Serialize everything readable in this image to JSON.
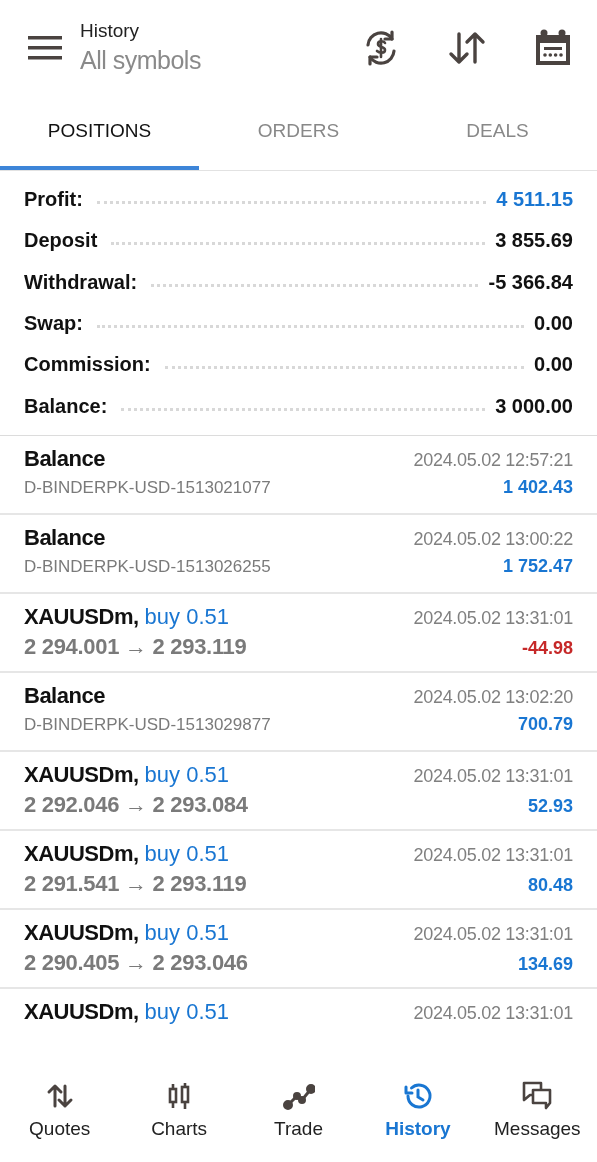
{
  "header": {
    "title": "History",
    "subtitle": "All symbols"
  },
  "tabs": [
    {
      "label": "POSITIONS",
      "selected": true
    },
    {
      "label": "ORDERS",
      "selected": false
    },
    {
      "label": "DEALS",
      "selected": false
    }
  ],
  "summary": [
    {
      "label": "Profit:",
      "value": "4 511.15",
      "color": "#1976d2"
    },
    {
      "label": "Deposit",
      "value": "3 855.69",
      "color": "#111111"
    },
    {
      "label": "Withdrawal:",
      "value": "-5 366.84",
      "color": "#111111"
    },
    {
      "label": "Swap:",
      "value": "0.00",
      "color": "#111111"
    },
    {
      "label": "Commission:",
      "value": "0.00",
      "color": "#111111"
    },
    {
      "label": "Balance:",
      "value": "3 000.00",
      "color": "#111111"
    }
  ],
  "rows": [
    {
      "kind": "balance",
      "title": "Balance",
      "time": "2024.05.02 12:57:21",
      "detail": "D-BINDERPK-USD-1513021077",
      "amount": "1 402.43",
      "color": "#1976d2"
    },
    {
      "kind": "balance",
      "title": "Balance",
      "time": "2024.05.02 13:00:22",
      "detail": "D-BINDERPK-USD-1513026255",
      "amount": "1 752.47",
      "color": "#1976d2"
    },
    {
      "kind": "trade",
      "title": "XAUUSDm,",
      "direction": "buy 0.51",
      "time": "2024.05.02 13:31:01",
      "open": "2 294.001",
      "arrow": "→",
      "close": "2 293.119",
      "amount": "-44.98",
      "color": "#c62828"
    },
    {
      "kind": "balance",
      "title": "Balance",
      "time": "2024.05.02 13:02:20",
      "detail": "D-BINDERPK-USD-1513029877",
      "amount": "700.79",
      "color": "#1976d2"
    },
    {
      "kind": "trade",
      "title": "XAUUSDm,",
      "direction": "buy 0.51",
      "time": "2024.05.02 13:31:01",
      "open": "2 292.046",
      "arrow": "→",
      "close": "2 293.084",
      "amount": "52.93",
      "color": "#1976d2"
    },
    {
      "kind": "trade",
      "title": "XAUUSDm,",
      "direction": "buy 0.51",
      "time": "2024.05.02 13:31:01",
      "open": "2 291.541",
      "arrow": "→",
      "close": "2 293.119",
      "amount": "80.48",
      "color": "#1976d2"
    },
    {
      "kind": "trade",
      "title": "XAUUSDm,",
      "direction": "buy 0.51",
      "time": "2024.05.02 13:31:01",
      "open": "2 290.405",
      "arrow": "→",
      "close": "2 293.046",
      "amount": "134.69",
      "color": "#1976d2"
    },
    {
      "kind": "trade",
      "title": "XAUUSDm,",
      "direction": "buy 0.51",
      "time": "2024.05.02 13:31:01"
    }
  ],
  "nav": [
    {
      "label": "Quotes",
      "kind": "quotes",
      "selected": false
    },
    {
      "label": "Charts",
      "kind": "charts",
      "selected": false
    },
    {
      "label": "Trade",
      "kind": "trade",
      "selected": false
    },
    {
      "label": "History",
      "kind": "history",
      "selected": true
    },
    {
      "label": "Messages",
      "kind": "messages",
      "selected": false
    }
  ]
}
